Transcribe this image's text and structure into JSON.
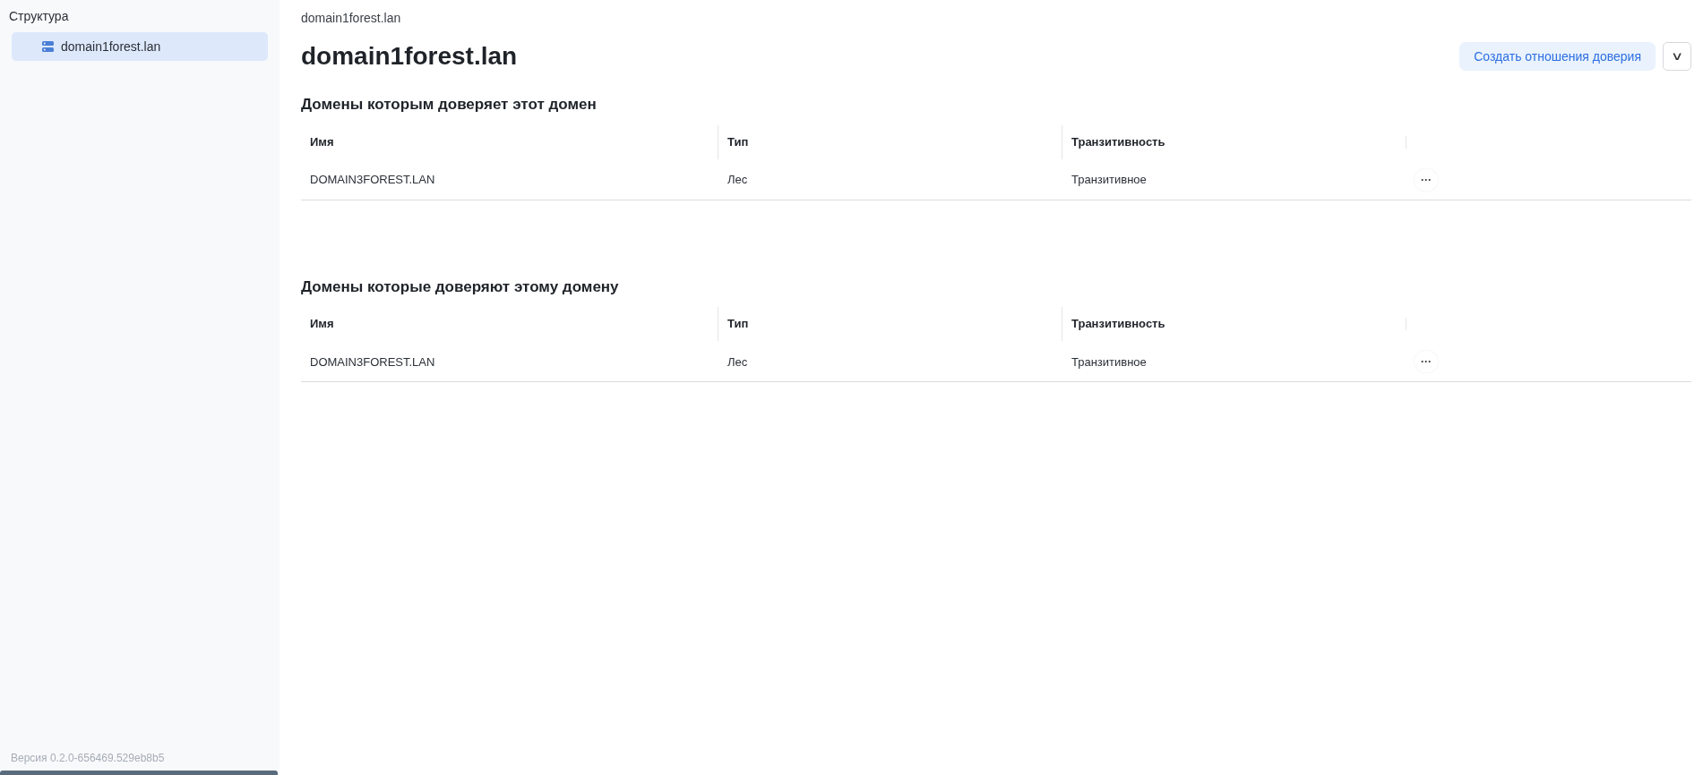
{
  "sidebar": {
    "title": "Структура",
    "items": [
      {
        "label": "domain1forest.lan",
        "selected": true
      }
    ],
    "version": "Версия 0.2.0-656469.529eb8b5"
  },
  "breadcrumb": "domain1forest.lan",
  "page_title": "domain1forest.lan",
  "actions": {
    "primary": "Создать отношения доверия",
    "dropdown": "∨"
  },
  "sections": [
    {
      "title": "Домены которым доверяет этот домен",
      "columns": [
        "Имя",
        "Тип",
        "Транзитивность"
      ],
      "rows": [
        {
          "cells": [
            "DOMAIN3FOREST.LAN",
            "Лес",
            "Транзитивное"
          ],
          "menu": "···"
        }
      ]
    },
    {
      "title": "Домены которые доверяют этому домену",
      "columns": [
        "Имя",
        "Тип",
        "Транзитивность"
      ],
      "rows": [
        {
          "cells": [
            "DOMAIN3FOREST.LAN",
            "Лес",
            "Транзитивное"
          ],
          "menu": "···"
        }
      ]
    }
  ]
}
